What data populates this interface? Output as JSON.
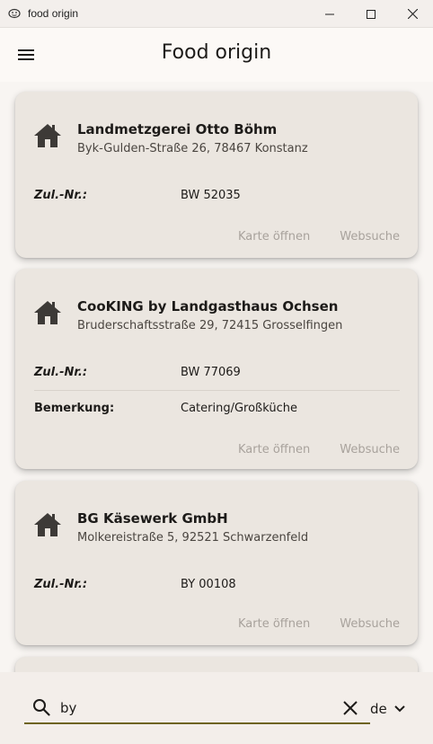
{
  "window": {
    "title": "food origin",
    "controls": [
      "minimize-icon",
      "maximize-icon",
      "close-icon"
    ]
  },
  "appbar": {
    "title": "Food origin",
    "menu_icon": "menu-icon"
  },
  "cards": [
    {
      "icon": "house-icon",
      "name": "Landmetzgerei Otto Böhm",
      "address": "Byk-Gulden-Straße 26, 78467 Konstanz",
      "rows": [
        {
          "label": "Zul.-Nr.:",
          "value": "BW 52035"
        }
      ],
      "actions": [
        "Karte öffnen",
        "Websuche"
      ]
    },
    {
      "icon": "house-icon",
      "name": "CooKING by Landgasthaus Ochsen",
      "address": "Bruderschaftsstraße 29, 72415 Grosselfingen",
      "rows": [
        {
          "label": "Zul.-Nr.:",
          "value": "BW 77069"
        },
        {
          "label": "Bemerkung:",
          "value": "Catering/Großküche"
        }
      ],
      "actions": [
        "Karte öffnen",
        "Websuche"
      ]
    },
    {
      "icon": "house-icon",
      "name": "BG Käsewerk GmbH",
      "address": "Molkereistraße 5, 92521 Schwarzenfeld",
      "rows": [
        {
          "label": "Zul.-Nr.:",
          "value": "BY 00108"
        }
      ],
      "actions": [
        "Karte öffnen",
        "Websuche"
      ]
    }
  ],
  "search": {
    "icon": "search-icon",
    "value": "by",
    "clear_icon": "close-icon"
  },
  "language": {
    "selected": "de",
    "icon": "chevron-down-icon"
  },
  "colors": {
    "card_bg": "#ebe6e0",
    "accent_underline": "#6e6420",
    "action_text": "#a8a29c"
  }
}
